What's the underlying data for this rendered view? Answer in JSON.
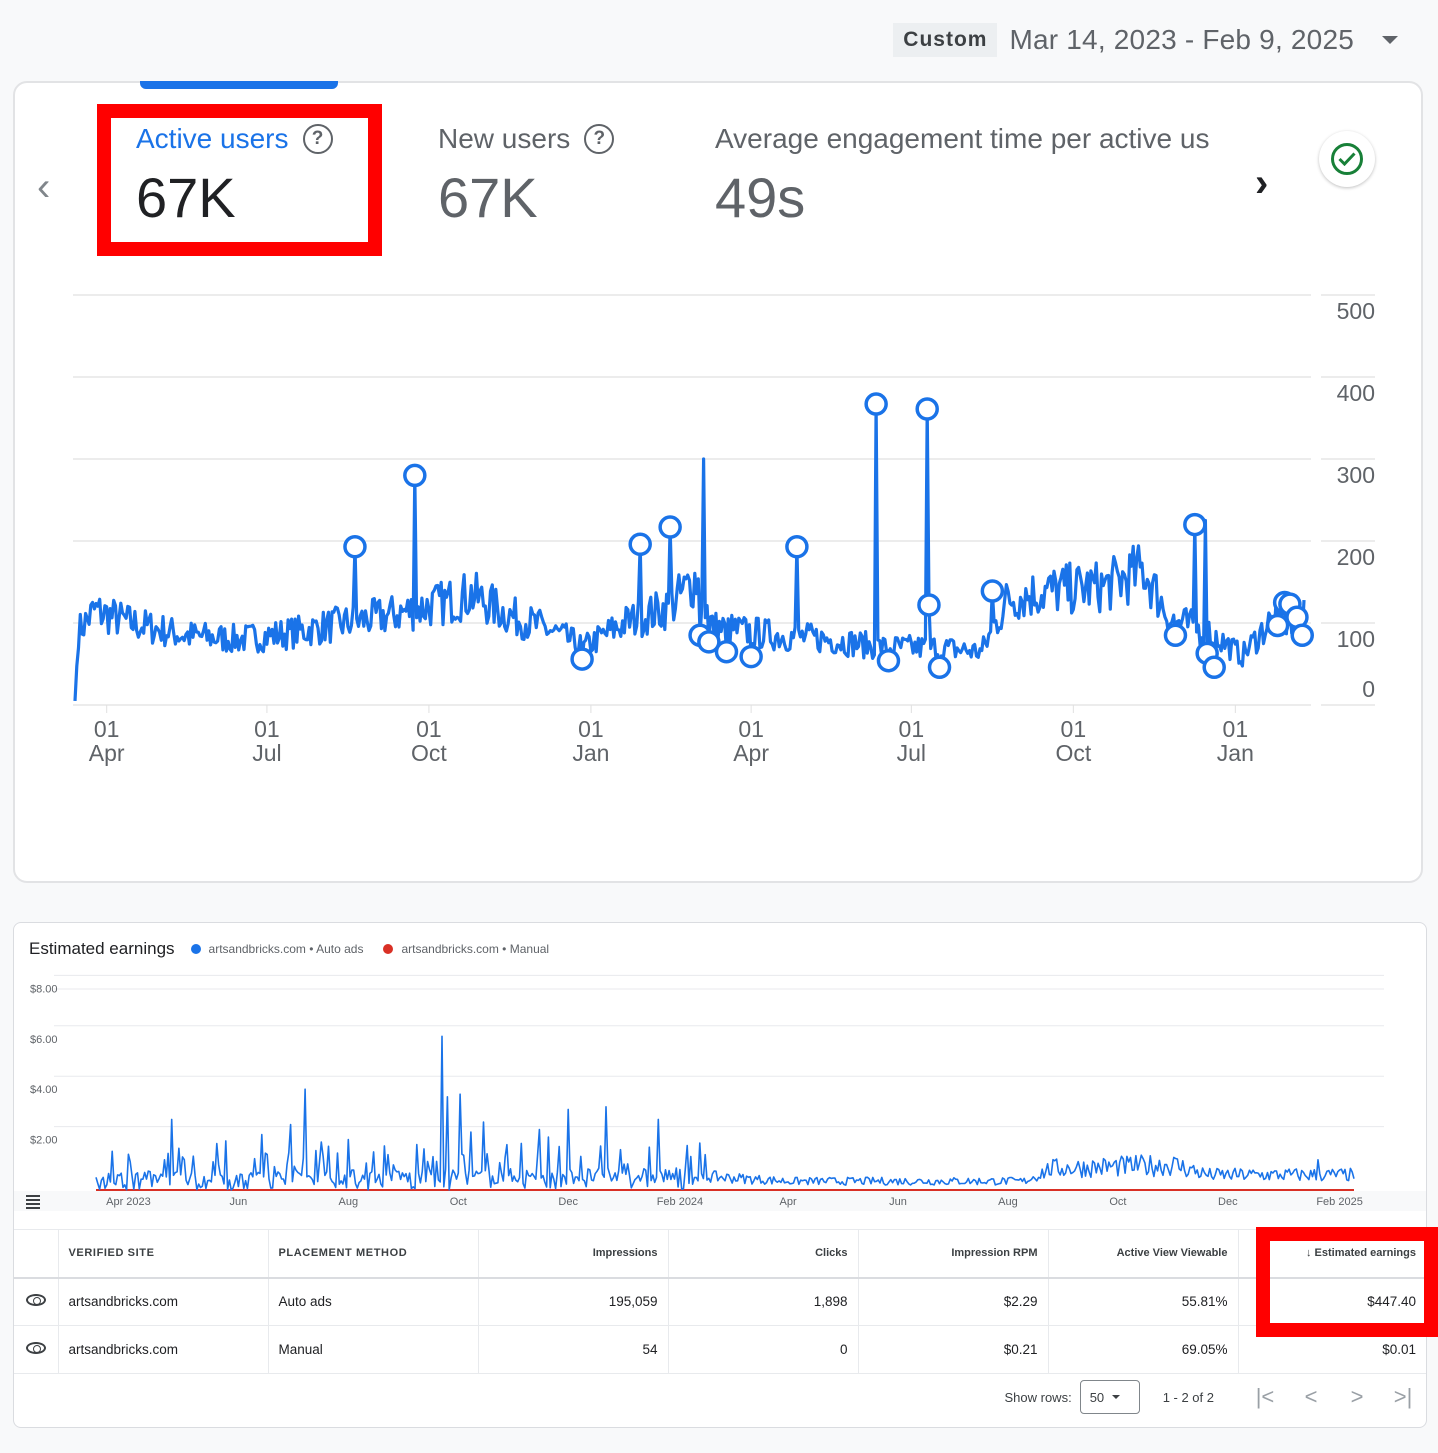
{
  "date_range": {
    "preset": "Custom",
    "value": "Mar 14, 2023 - Feb 9, 2025"
  },
  "metrics": [
    {
      "label": "Active users",
      "value": "67K",
      "selected": true,
      "help": "?"
    },
    {
      "label": "New users",
      "value": "67K",
      "selected": false,
      "help": "?"
    },
    {
      "label": "Average engagement time per active us",
      "value": "49s",
      "selected": false
    }
  ],
  "icons": {
    "prev": "‹",
    "next": "›",
    "check": "✓",
    "sort_desc": "↓",
    "first_page": "|<",
    "prev_page": "<",
    "next_page": ">",
    "last_page": ">|"
  },
  "colors": {
    "accent": "#1a73e8",
    "highlight": "#ff0000",
    "manual_series": "#d93025",
    "check": "#188038"
  },
  "chart_data": [
    {
      "type": "line",
      "title": "Active users",
      "series_name": "Active users",
      "ylim": [
        0,
        500
      ],
      "yticks": [
        0,
        100,
        200,
        300,
        400,
        500
      ],
      "xlabel": "",
      "ylabel": "",
      "x_range": [
        "2023-03-14",
        "2025-02-09"
      ],
      "xticks": [
        {
          "date": "2023-04-01",
          "day": "01",
          "month": "Apr"
        },
        {
          "date": "2023-07-01",
          "day": "01",
          "month": "Jul"
        },
        {
          "date": "2023-10-01",
          "day": "01",
          "month": "Oct"
        },
        {
          "date": "2024-01-01",
          "day": "01",
          "month": "Jan"
        },
        {
          "date": "2024-04-01",
          "day": "01",
          "month": "Apr"
        },
        {
          "date": "2024-07-01",
          "day": "01",
          "month": "Jul"
        },
        {
          "date": "2024-10-01",
          "day": "01",
          "month": "Oct"
        },
        {
          "date": "2025-01-01",
          "day": "01",
          "month": "Jan"
        }
      ],
      "trend": [
        {
          "date": "2023-03-14",
          "value": 5
        },
        {
          "date": "2023-03-16",
          "value": 90
        },
        {
          "date": "2023-03-25",
          "value": 115
        },
        {
          "date": "2023-04-15",
          "value": 100
        },
        {
          "date": "2023-05-15",
          "value": 85
        },
        {
          "date": "2023-06-15",
          "value": 80
        },
        {
          "date": "2023-07-15",
          "value": 88
        },
        {
          "date": "2023-08-15",
          "value": 100
        },
        {
          "date": "2023-09-10",
          "value": 110
        },
        {
          "date": "2023-10-10",
          "value": 125
        },
        {
          "date": "2023-10-25",
          "value": 135
        },
        {
          "date": "2023-11-15",
          "value": 110
        },
        {
          "date": "2023-12-10",
          "value": 90
        },
        {
          "date": "2023-12-28",
          "value": 70
        },
        {
          "date": "2024-01-20",
          "value": 100
        },
        {
          "date": "2024-02-15",
          "value": 120
        },
        {
          "date": "2024-03-01",
          "value": 155
        },
        {
          "date": "2024-03-10",
          "value": 95
        },
        {
          "date": "2024-04-15",
          "value": 85
        },
        {
          "date": "2024-05-15",
          "value": 80
        },
        {
          "date": "2024-06-15",
          "value": 70
        },
        {
          "date": "2024-07-15",
          "value": 70
        },
        {
          "date": "2024-08-10",
          "value": 65
        },
        {
          "date": "2024-08-25",
          "value": 130
        },
        {
          "date": "2024-09-20",
          "value": 140
        },
        {
          "date": "2024-10-20",
          "value": 145
        },
        {
          "date": "2024-11-10",
          "value": 165
        },
        {
          "date": "2024-11-25",
          "value": 105
        },
        {
          "date": "2024-12-20",
          "value": 85
        },
        {
          "date": "2025-01-05",
          "value": 60
        },
        {
          "date": "2025-01-20",
          "value": 100
        },
        {
          "date": "2025-02-09",
          "value": 105
        }
      ],
      "spikes": [
        {
          "date": "2024-03-05",
          "value": 300
        },
        {
          "date": "2024-12-15",
          "value": 225
        }
      ],
      "anomalies": [
        {
          "date": "2023-08-20",
          "value": 193
        },
        {
          "date": "2023-09-23",
          "value": 280
        },
        {
          "date": "2023-12-27",
          "value": 56
        },
        {
          "date": "2024-01-29",
          "value": 196
        },
        {
          "date": "2024-02-15",
          "value": 217
        },
        {
          "date": "2024-03-03",
          "value": 85
        },
        {
          "date": "2024-03-08",
          "value": 77
        },
        {
          "date": "2024-03-18",
          "value": 65
        },
        {
          "date": "2024-04-01",
          "value": 59
        },
        {
          "date": "2024-04-27",
          "value": 193
        },
        {
          "date": "2024-06-11",
          "value": 367
        },
        {
          "date": "2024-06-18",
          "value": 54
        },
        {
          "date": "2024-07-10",
          "value": 361
        },
        {
          "date": "2024-07-11",
          "value": 122
        },
        {
          "date": "2024-07-17",
          "value": 46
        },
        {
          "date": "2024-08-16",
          "value": 139
        },
        {
          "date": "2024-11-28",
          "value": 85
        },
        {
          "date": "2024-12-09",
          "value": 220
        },
        {
          "date": "2024-12-16",
          "value": 63
        },
        {
          "date": "2024-12-20",
          "value": 46
        },
        {
          "date": "2025-01-25",
          "value": 97
        },
        {
          "date": "2025-01-29",
          "value": 125
        },
        {
          "date": "2025-02-01",
          "value": 123
        },
        {
          "date": "2025-02-05",
          "value": 107
        },
        {
          "date": "2025-02-08",
          "value": 85
        }
      ]
    },
    {
      "type": "line",
      "title": "Estimated earnings",
      "ylim": [
        0,
        8
      ],
      "yticks": [
        "$2.00",
        "$4.00",
        "$6.00",
        "$8.00"
      ],
      "ytick_values": [
        2,
        4,
        6,
        8
      ],
      "x_range": [
        "2023-03-14",
        "2025-02-09"
      ],
      "xticks": [
        {
          "date": "2023-04-01",
          "label": "Apr 2023"
        },
        {
          "date": "2023-06-01",
          "label": "Jun"
        },
        {
          "date": "2023-08-01",
          "label": "Aug"
        },
        {
          "date": "2023-10-01",
          "label": "Oct"
        },
        {
          "date": "2023-12-01",
          "label": "Dec"
        },
        {
          "date": "2024-02-01",
          "label": "Feb 2024"
        },
        {
          "date": "2024-04-01",
          "label": "Apr"
        },
        {
          "date": "2024-06-01",
          "label": "Jun"
        },
        {
          "date": "2024-08-01",
          "label": "Aug"
        },
        {
          "date": "2024-10-01",
          "label": "Oct"
        },
        {
          "date": "2024-12-01",
          "label": "Dec"
        },
        {
          "date": "2025-02-01",
          "label": "Feb 2025"
        }
      ],
      "series": [
        {
          "name": "artsandbricks.com • Auto ads",
          "color": "#1a73e8",
          "baseline": [
            {
              "date": "2023-03-14",
              "value": 0.5
            },
            {
              "date": "2024-02-01",
              "value": 0.6
            },
            {
              "date": "2024-04-01",
              "value": 0.35
            },
            {
              "date": "2024-08-10",
              "value": 0.35
            },
            {
              "date": "2024-08-25",
              "value": 0.85
            },
            {
              "date": "2024-11-01",
              "value": 1.0
            },
            {
              "date": "2024-11-20",
              "value": 0.6
            },
            {
              "date": "2025-02-09",
              "value": 0.6
            }
          ],
          "peaks": [
            {
              "date": "2023-04-25",
              "value": 2.8
            },
            {
              "date": "2023-05-25",
              "value": 1.95
            },
            {
              "date": "2023-06-14",
              "value": 2.2
            },
            {
              "date": "2023-06-30",
              "value": 2.6
            },
            {
              "date": "2023-07-08",
              "value": 4.0
            },
            {
              "date": "2023-07-17",
              "value": 1.9
            },
            {
              "date": "2023-08-01",
              "value": 2.0
            },
            {
              "date": "2023-08-21",
              "value": 1.75
            },
            {
              "date": "2023-09-08",
              "value": 1.8
            },
            {
              "date": "2023-09-22",
              "value": 6.1
            },
            {
              "date": "2023-09-25",
              "value": 3.7
            },
            {
              "date": "2023-10-02",
              "value": 3.8
            },
            {
              "date": "2023-10-08",
              "value": 2.3
            },
            {
              "date": "2023-10-15",
              "value": 2.7
            },
            {
              "date": "2023-11-05",
              "value": 1.85
            },
            {
              "date": "2023-11-15",
              "value": 2.4
            },
            {
              "date": "2023-11-20",
              "value": 2.1
            },
            {
              "date": "2023-12-01",
              "value": 3.2
            },
            {
              "date": "2023-12-22",
              "value": 3.3
            },
            {
              "date": "2024-01-20",
              "value": 2.8
            },
            {
              "date": "2024-02-15",
              "value": 1.4
            },
            {
              "date": "2025-01-20",
              "value": 1.2
            }
          ]
        },
        {
          "name": "artsandbricks.com • Manual",
          "color": "#d93025",
          "constant_value": 0.0
        }
      ],
      "legend_position": "top-left"
    }
  ],
  "table": {
    "columns": [
      {
        "label": "",
        "align": "l"
      },
      {
        "label": "VERIFIED SITE",
        "align": "l"
      },
      {
        "label": "PLACEMENT METHOD",
        "align": "l"
      },
      {
        "label": "Impressions",
        "align": "r"
      },
      {
        "label": "Clicks",
        "align": "r"
      },
      {
        "label": "Impression RPM",
        "align": "r"
      },
      {
        "label": "Active View Viewable",
        "align": "r"
      },
      {
        "label": "Estimated earnings",
        "align": "r",
        "sorted": "desc"
      }
    ],
    "rows": [
      {
        "site": "artsandbricks.com",
        "placement": "Auto ads",
        "impressions": "195,059",
        "clicks": "1,898",
        "rpm": "$2.29",
        "viewable": "55.81%",
        "earnings": "$447.40"
      },
      {
        "site": "artsandbricks.com",
        "placement": "Manual",
        "impressions": "54",
        "clicks": "0",
        "rpm": "$0.21",
        "viewable": "69.05%",
        "earnings": "$0.01"
      }
    ],
    "pagination": {
      "show_rows_label": "Show rows:",
      "rows_per_page": "50",
      "range_text": "1 - 2 of 2"
    }
  }
}
